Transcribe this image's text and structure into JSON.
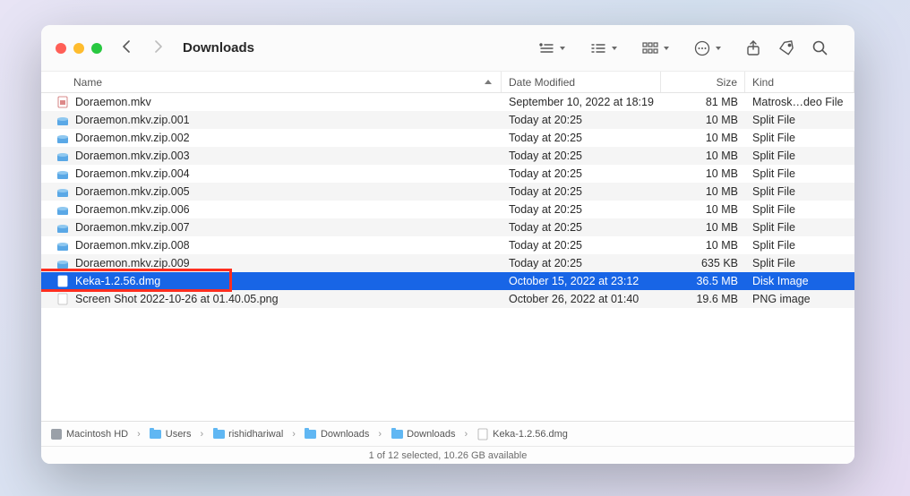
{
  "window": {
    "title": "Downloads"
  },
  "columns": {
    "name": "Name",
    "date": "Date Modified",
    "size": "Size",
    "kind": "Kind"
  },
  "files": [
    {
      "icon": "mkv",
      "name": "Doraemon.mkv",
      "date": "September 10, 2022 at 18:19",
      "size": "81 MB",
      "kind": "Matrosk…deo File",
      "selected": false
    },
    {
      "icon": "split",
      "name": "Doraemon.mkv.zip.001",
      "date": "Today at 20:25",
      "size": "10 MB",
      "kind": "Split File",
      "selected": false
    },
    {
      "icon": "split",
      "name": "Doraemon.mkv.zip.002",
      "date": "Today at 20:25",
      "size": "10 MB",
      "kind": "Split File",
      "selected": false
    },
    {
      "icon": "split",
      "name": "Doraemon.mkv.zip.003",
      "date": "Today at 20:25",
      "size": "10 MB",
      "kind": "Split File",
      "selected": false
    },
    {
      "icon": "split",
      "name": "Doraemon.mkv.zip.004",
      "date": "Today at 20:25",
      "size": "10 MB",
      "kind": "Split File",
      "selected": false
    },
    {
      "icon": "split",
      "name": "Doraemon.mkv.zip.005",
      "date": "Today at 20:25",
      "size": "10 MB",
      "kind": "Split File",
      "selected": false
    },
    {
      "icon": "split",
      "name": "Doraemon.mkv.zip.006",
      "date": "Today at 20:25",
      "size": "10 MB",
      "kind": "Split File",
      "selected": false
    },
    {
      "icon": "split",
      "name": "Doraemon.mkv.zip.007",
      "date": "Today at 20:25",
      "size": "10 MB",
      "kind": "Split File",
      "selected": false
    },
    {
      "icon": "split",
      "name": "Doraemon.mkv.zip.008",
      "date": "Today at 20:25",
      "size": "10 MB",
      "kind": "Split File",
      "selected": false
    },
    {
      "icon": "split",
      "name": "Doraemon.mkv.zip.009",
      "date": "Today at 20:25",
      "size": "635 KB",
      "kind": "Split File",
      "selected": false
    },
    {
      "icon": "dmg",
      "name": "Keka-1.2.56.dmg",
      "date": "October 15, 2022 at 23:12",
      "size": "36.5 MB",
      "kind": "Disk Image",
      "selected": true
    },
    {
      "icon": "png",
      "name": "Screen Shot 2022-10-26 at 01.40.05.png",
      "date": "October 26, 2022 at 01:40",
      "size": "19.6 MB",
      "kind": "PNG image",
      "selected": false
    }
  ],
  "breadcrumbs": [
    {
      "icon": "hd",
      "label": "Macintosh HD"
    },
    {
      "icon": "folder",
      "label": "Users"
    },
    {
      "icon": "folder",
      "label": "rishidhariwal"
    },
    {
      "icon": "folder",
      "label": "Downloads"
    },
    {
      "icon": "folder",
      "label": "Downloads"
    },
    {
      "icon": "file",
      "label": "Keka-1.2.56.dmg"
    }
  ],
  "status": "1 of 12 selected, 10.26 GB available"
}
